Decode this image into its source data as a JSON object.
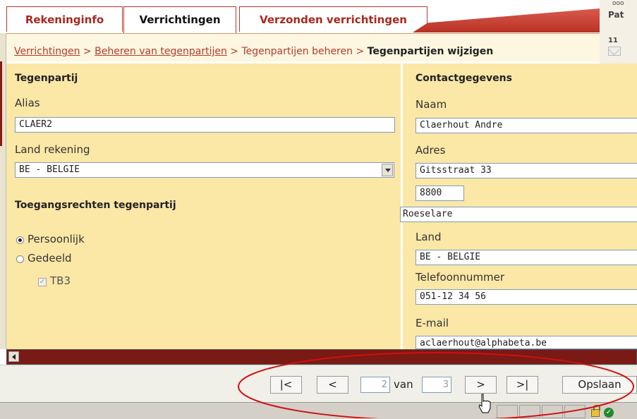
{
  "tabs": [
    {
      "label": "Rekeninginfo"
    },
    {
      "label": "Verrichtingen"
    },
    {
      "label": "Verzonden verrichtingen"
    }
  ],
  "header": {
    "user_partial": "Pat",
    "top_partial": "ooo",
    "mail_count": "11"
  },
  "breadcrumb": {
    "items": [
      "Verrichtingen",
      "Beheren van tegenpartijen",
      "Tegenpartijen beheren"
    ],
    "separator": ">",
    "current": "Tegenpartijen wijzigen"
  },
  "left": {
    "section_title": "Tegenpartij",
    "alias_label": "Alias",
    "alias_value": "CLAER2",
    "land_rekening_label": "Land rekening",
    "land_rekening_value": "BE - BELGIE",
    "rights_title": "Toegangsrechten tegenpartij",
    "radio_personal": "Persoonlijk",
    "radio_shared": "Gedeeld",
    "checkbox_label": "TB3"
  },
  "right": {
    "section_title": "Contactgegevens",
    "naam_label": "Naam",
    "naam_value": "Claerhout Andre",
    "adres_label": "Adres",
    "adres_value": "Gitsstraat 33",
    "postcode_value": "8800",
    "gemeente_value": "Roeselare",
    "land_label": "Land",
    "land_value": "BE - BELGIE",
    "telefoon_label": "Telefoonnummer",
    "telefoon_value": "051-12 34 56",
    "email_label": "E-mail",
    "email_value": "aclaerhout@alphabeta.be"
  },
  "pager": {
    "first": "|<",
    "prev": "<",
    "current_page": "2",
    "van": "van",
    "total_pages": "3",
    "next": ">",
    "last": ">|",
    "save": "Opslaan"
  },
  "colors": {
    "accent": "#b33c2c",
    "panel": "#fbe7a6",
    "dark_red": "#7a1a14",
    "highlight_oval": "#d01010"
  }
}
